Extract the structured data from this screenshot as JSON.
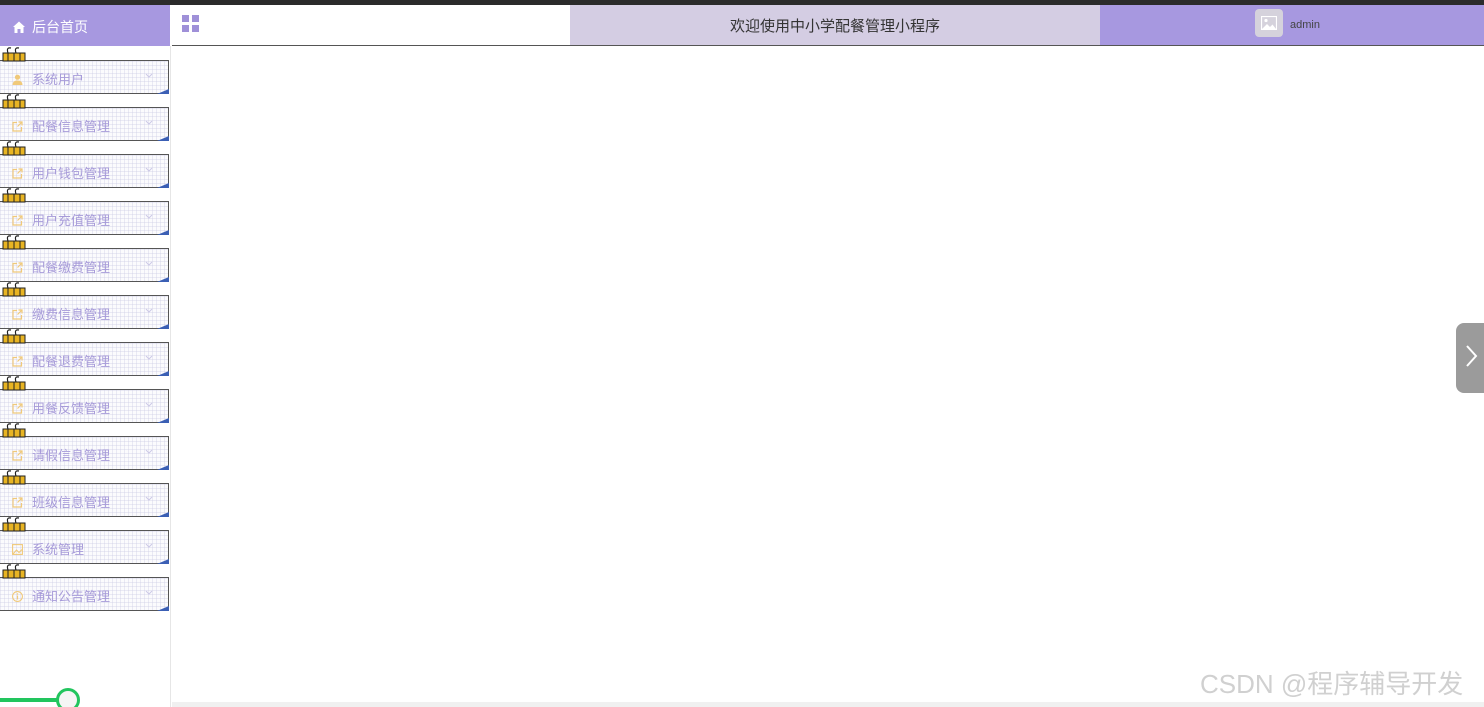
{
  "header": {
    "home_label": "后台首页",
    "title": "欢迎使用中小学配餐管理小程序",
    "username": "admin"
  },
  "sidebar": {
    "items": [
      {
        "label": "系统用户",
        "icon": "user-icon"
      },
      {
        "label": "配餐信息管理",
        "icon": "external-link-icon"
      },
      {
        "label": "用户钱包管理",
        "icon": "external-link-icon"
      },
      {
        "label": "用户充值管理",
        "icon": "external-link-icon"
      },
      {
        "label": "配餐缴费管理",
        "icon": "external-link-icon"
      },
      {
        "label": "缴费信息管理",
        "icon": "external-link-icon"
      },
      {
        "label": "配餐退费管理",
        "icon": "external-link-icon"
      },
      {
        "label": "用餐反馈管理",
        "icon": "external-link-icon"
      },
      {
        "label": "请假信息管理",
        "icon": "external-link-icon"
      },
      {
        "label": "班级信息管理",
        "icon": "external-link-icon"
      },
      {
        "label": "系统管理",
        "icon": "picture-icon"
      },
      {
        "label": "通知公告管理",
        "icon": "info-icon"
      }
    ]
  },
  "watermark": "CSDN @程序辅导开发",
  "colors": {
    "accent": "#a798e0",
    "title_bar": "#d4cde3",
    "menu_text": "#a79bd9",
    "menu_icon": "#f0c97a",
    "slider": "#22c55e"
  }
}
